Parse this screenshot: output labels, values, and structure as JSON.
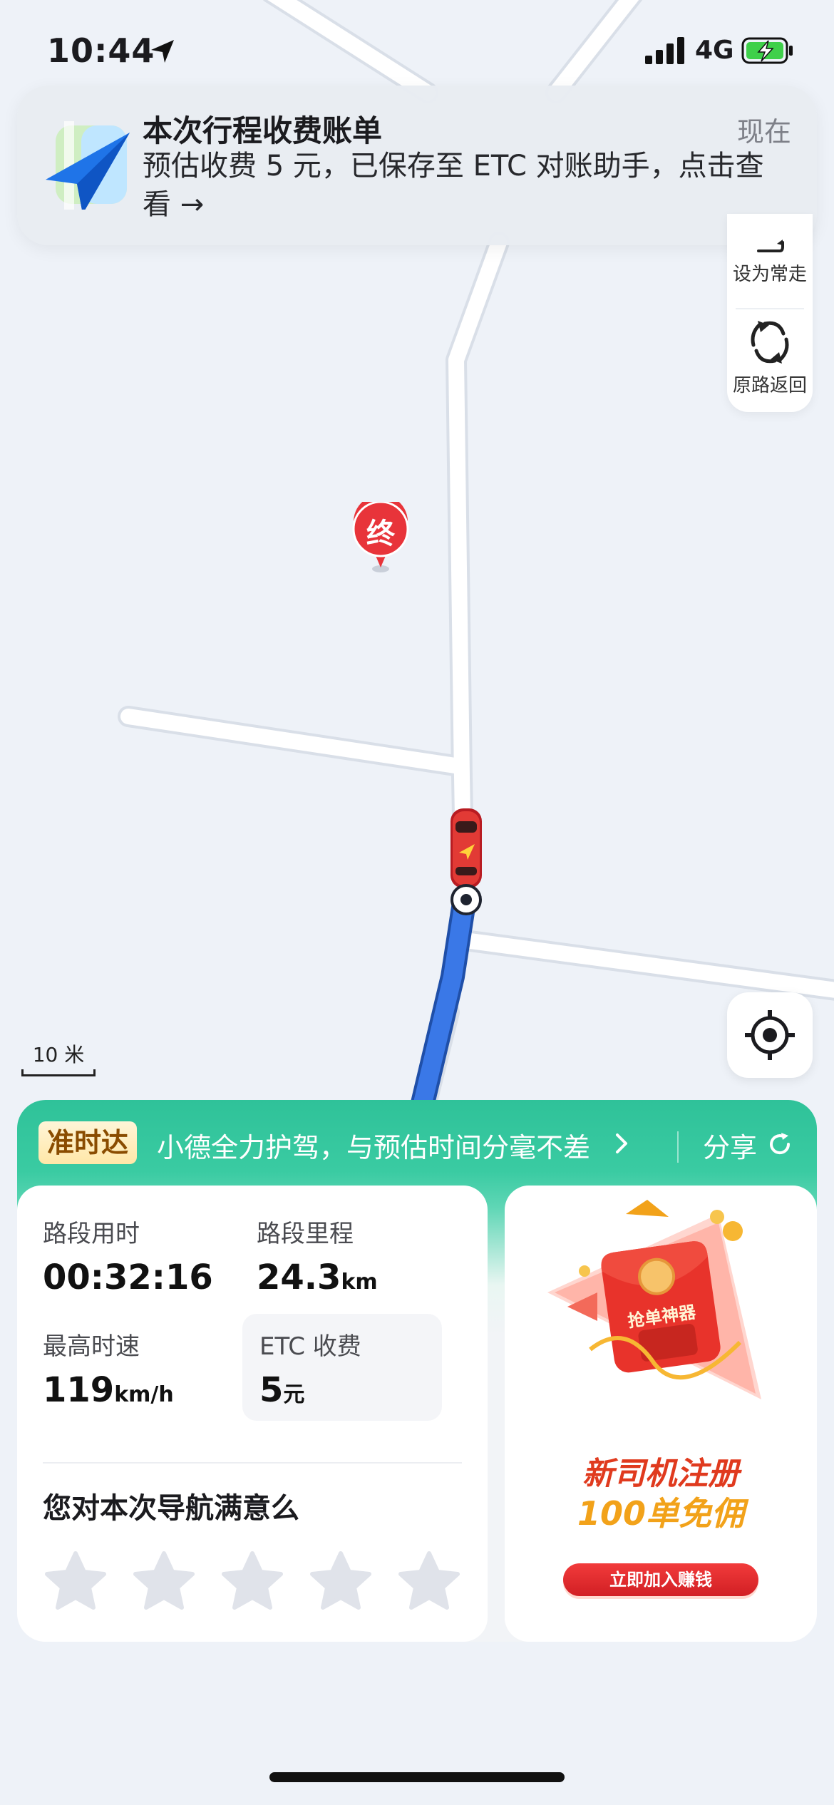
{
  "status_bar": {
    "time": "10:44",
    "network": "4G",
    "icons": [
      "location-arrow-icon",
      "signal-bars-icon",
      "charging-battery-icon"
    ]
  },
  "notification": {
    "app_icon": "amap-paper-plane-icon",
    "title": "本次行程收费账单",
    "time": "现在",
    "body": "预估收费 5 元，已保存至 ETC 对账助手，点击查看 →"
  },
  "map": {
    "end_marker_label": "终",
    "scale_label": "10 米",
    "colors": {
      "route": "#3a78e7",
      "road": "#ffffff",
      "background": "#eef2f8",
      "marker": "#e8343a"
    }
  },
  "side_panel": {
    "items": [
      {
        "label": "设为常走",
        "icon": "route-save-icon"
      },
      {
        "label": "原路返回",
        "icon": "return-arrows-icon"
      }
    ]
  },
  "summary": {
    "badge": "准时达",
    "banner_text": "小德全力护驾，与预估时间分毫不差",
    "share_label": "分享",
    "stats": {
      "duration": {
        "label": "路段用时",
        "value": "00:32:16"
      },
      "distance": {
        "label": "路段里程",
        "value": "24.3",
        "unit": "km"
      },
      "max_speed": {
        "label": "最高时速",
        "value": "119",
        "unit": "km/h"
      },
      "etc_fee": {
        "label": "ETC 收费",
        "value": "5",
        "unit": "元"
      }
    },
    "rating_question": "您对本次导航满意么",
    "rating": {
      "max": 5,
      "selected": 0
    }
  },
  "promo": {
    "envelope_text": "抢单神器",
    "line1": "新司机注册",
    "line2": "100单免佣",
    "cta": "立即加入赚钱"
  }
}
